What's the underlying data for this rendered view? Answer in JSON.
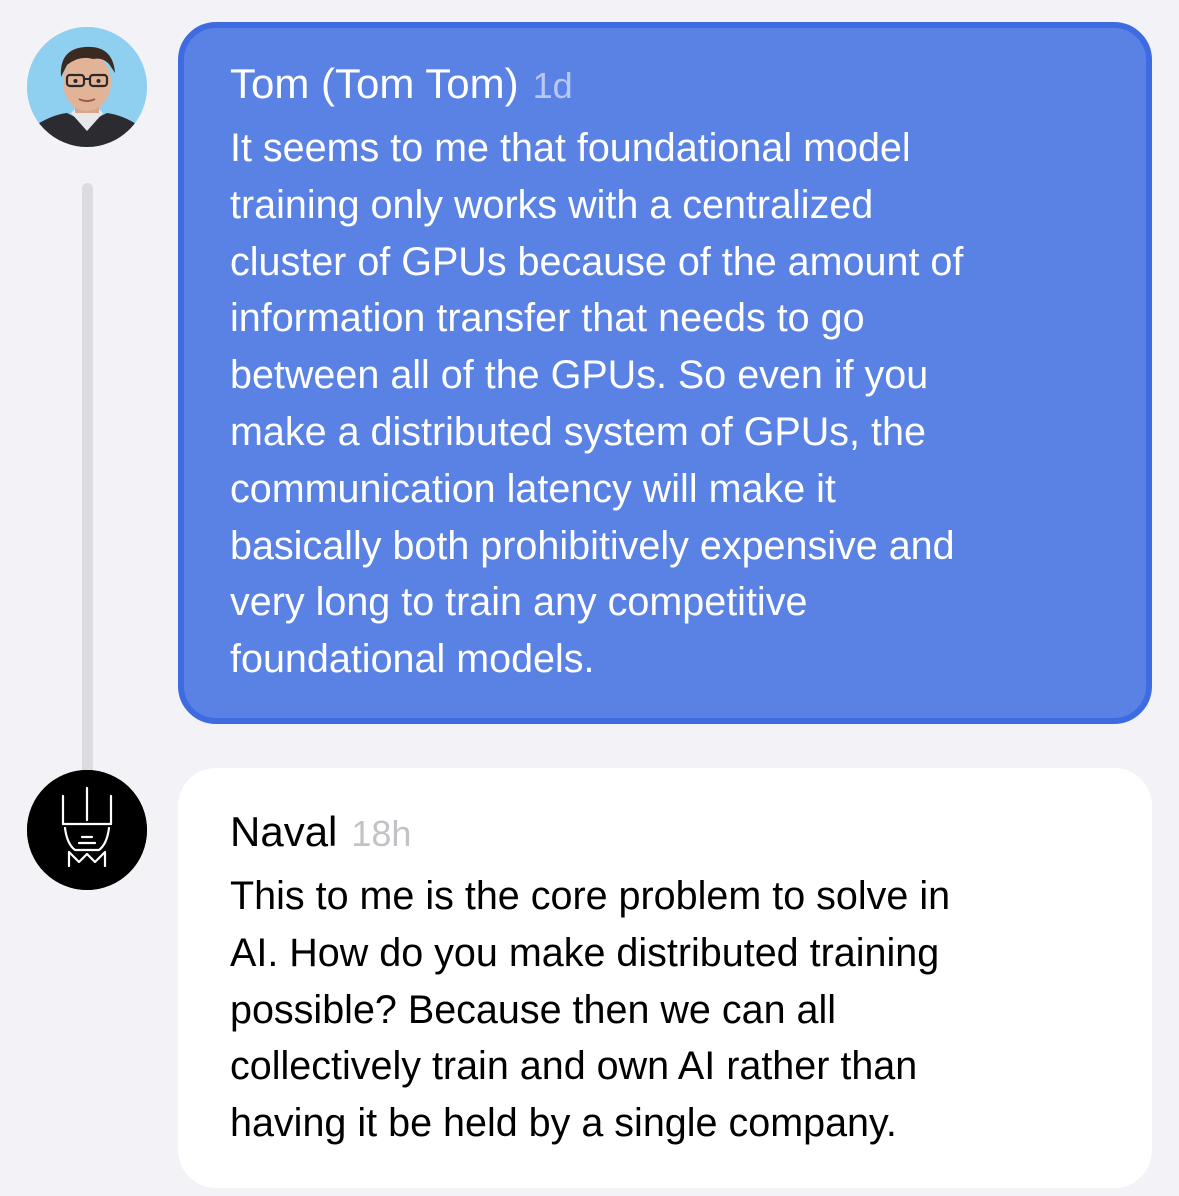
{
  "messages": [
    {
      "author": "Tom (Tom Tom)",
      "time": "1d",
      "avatar": "tom-avatar-illustration",
      "lines": [
        "It seems to me that foundational model",
        "training only works with a centralized",
        "cluster of GPUs because of the amount of",
        "information transfer that needs to go",
        "between all of the GPUs. So even if you",
        "make a distributed system of GPUs, the",
        "communication latency will make it",
        "basically both prohibitively expensive and",
        "very long to train any competitive",
        "foundational models."
      ],
      "bubble_color": "#5a82e4",
      "border_color": "#3f6be0"
    },
    {
      "author": "Naval",
      "time": "18h",
      "avatar": "naval-logo-avatar",
      "lines": [
        "This to me is the core problem to solve in",
        "AI. How do you make distributed training",
        "possible? Because then we can all",
        "collectively train and own AI rather than",
        "having it be held by a single company."
      ],
      "bubble_color": "#ffffff"
    }
  ],
  "colors": {
    "background": "#f3f2f7",
    "thread_line": "#dcdbe2"
  }
}
